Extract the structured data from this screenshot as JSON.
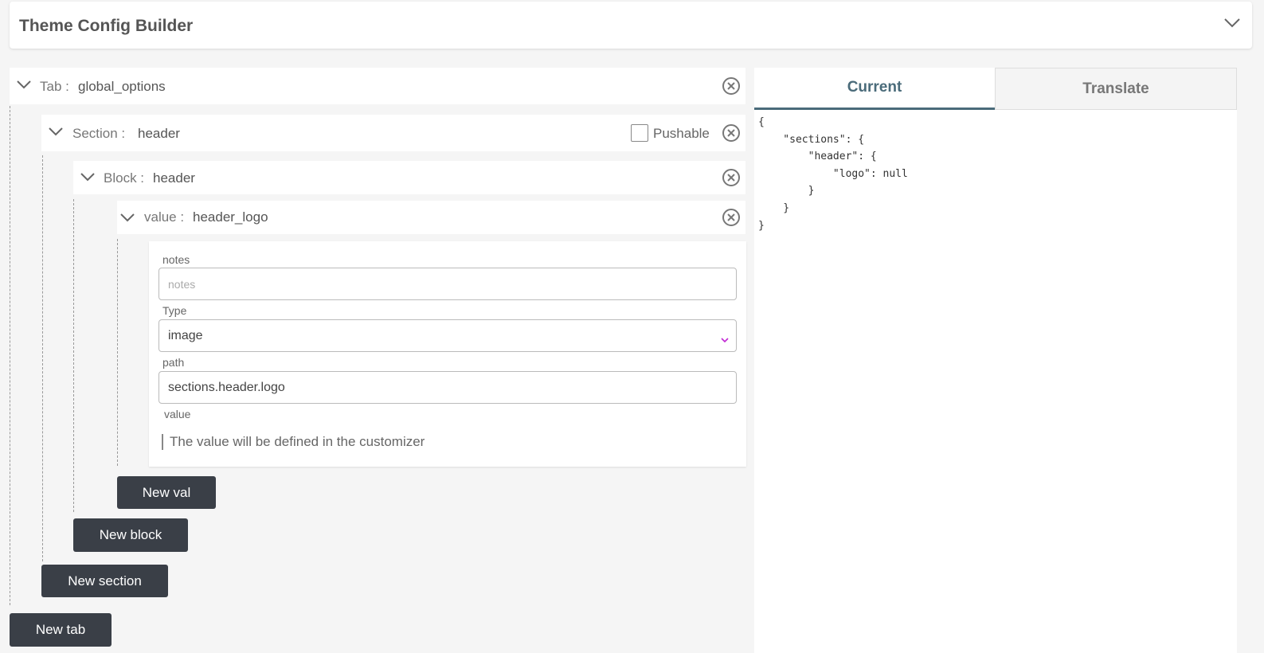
{
  "header": {
    "title": "Theme Config Builder",
    "toggle_icon": "chevron-down-icon"
  },
  "tab": {
    "label": "Tab :",
    "value": "global_options"
  },
  "section": {
    "label": "Section :",
    "value": "header",
    "pushable_label": "Pushable",
    "pushable_checked": false
  },
  "block": {
    "label": "Block :",
    "value": "header"
  },
  "value_row": {
    "label": "value :",
    "value": "header_logo"
  },
  "form": {
    "notes_label": "notes",
    "notes_placeholder": "notes",
    "type_label": "Type",
    "type_value": "image",
    "path_label": "path",
    "path_value": "sections.header.logo",
    "value_label": "value",
    "value_note": "The value will be defined in the customizer"
  },
  "buttons": {
    "new_val": "New val",
    "new_block": "New block",
    "new_section": "New section",
    "new_tab": "New tab"
  },
  "preview": {
    "tabs": [
      "Current",
      "Translate"
    ],
    "active_tab": "Current",
    "json_text": "{\n    \"sections\": {\n        \"header\": {\n            \"logo\": null\n        }\n    }\n}"
  },
  "colors": {
    "button_bg": "#3a3f47",
    "active_tab": "#4a6b7a",
    "select_arrow": "#c026d3"
  }
}
